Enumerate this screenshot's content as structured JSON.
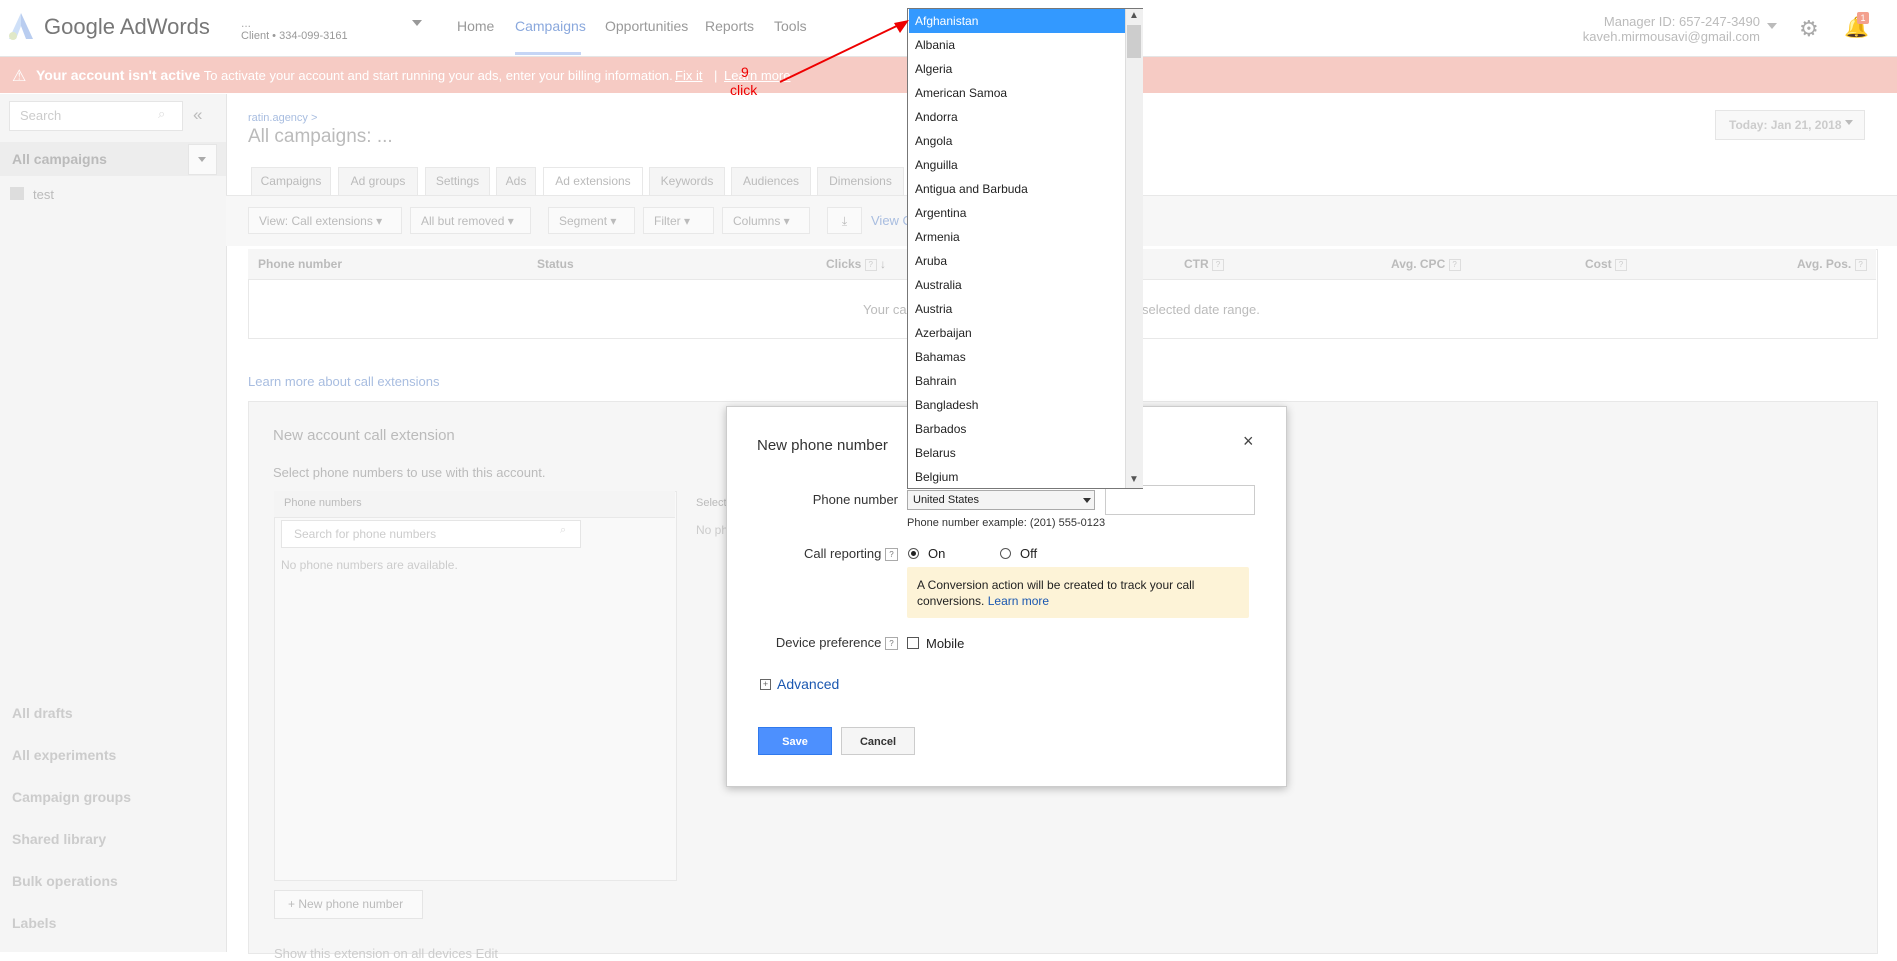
{
  "header": {
    "logo_text": "Google AdWords",
    "account_name": "...",
    "account_id": "Client  •  334-099-3161",
    "nav": [
      "Home",
      "Campaigns",
      "Opportunities",
      "Reports",
      "Tools"
    ],
    "manager_id": "Manager ID: 657-247-3490",
    "manager_email": "kaveh.mirmousavi@gmail.com",
    "notification_count": "1"
  },
  "alert": {
    "bold": "Your account isn't active",
    "text": " - To activate your account and start running your ads, enter your billing information.",
    "fix_link": "Fix it",
    "separator": "|",
    "learn_link": "Learn more"
  },
  "sidebar": {
    "search_placeholder": "Search",
    "collapse": "«",
    "all_campaigns": "All campaigns",
    "campaign": "test",
    "bottom": [
      "All drafts",
      "All experiments",
      "Campaign groups",
      "Shared library",
      "Bulk operations",
      "Labels"
    ]
  },
  "main": {
    "breadcrumb": "ratin.agency >",
    "title": "All campaigns: ...",
    "date": "Today: Jan 21, 2018",
    "tabs": [
      "Campaigns",
      "Ad groups",
      "Settings",
      "Ads",
      "Ad extensions",
      "Keywords",
      "Audiences",
      "Dimensions"
    ],
    "toolbar": [
      "View: Call extensions ▾",
      "All but removed ▾",
      "Segment ▾",
      "Filter ▾",
      "Columns ▾"
    ],
    "view_link": "View C",
    "columns": [
      "Phone number",
      "Status",
      "Clicks",
      "CTR",
      "Avg. CPC",
      "Cost",
      "Avg. Pos."
    ],
    "empty_left": "Your ca",
    "empty_right": "selected date range.",
    "learn_call": "Learn more about call extensions",
    "new_ext_title": "New account call extension",
    "new_ext_sub": "Select phone numbers to use with this account.",
    "phone_numbers_header": "Phone numbers",
    "pn_search_placeholder": "Search for phone numbers",
    "pn_none": "No phone numbers are available.",
    "select_col": "Select",
    "no_ph": "No ph",
    "new_pn_button": "New phone number",
    "show_ext": "Show this extension on all devices    Edit"
  },
  "dialog": {
    "title": "New phone number",
    "close": "×",
    "phone_label": "Phone number",
    "country": "United States",
    "example": "Phone number example: (201) 555-0123",
    "call_reporting_label": "Call reporting",
    "on": "On",
    "off": "Off",
    "note": "A Conversion action will be created to track your call conversions.",
    "note_link": "Learn more",
    "device_label": "Device preference",
    "mobile": "Mobile",
    "advanced": "Advanced",
    "save": "Save",
    "cancel": "Cancel"
  },
  "dropdown": {
    "options": [
      "Afghanistan",
      "Albania",
      "Algeria",
      "American Samoa",
      "Andorra",
      "Angola",
      "Anguilla",
      "Antigua and Barbuda",
      "Argentina",
      "Armenia",
      "Aruba",
      "Australia",
      "Austria",
      "Azerbaijan",
      "Bahamas",
      "Bahrain",
      "Bangladesh",
      "Barbados",
      "Belarus",
      "Belgium"
    ],
    "selected": "Afghanistan"
  },
  "annotation": {
    "step": "9",
    "action": "click"
  }
}
